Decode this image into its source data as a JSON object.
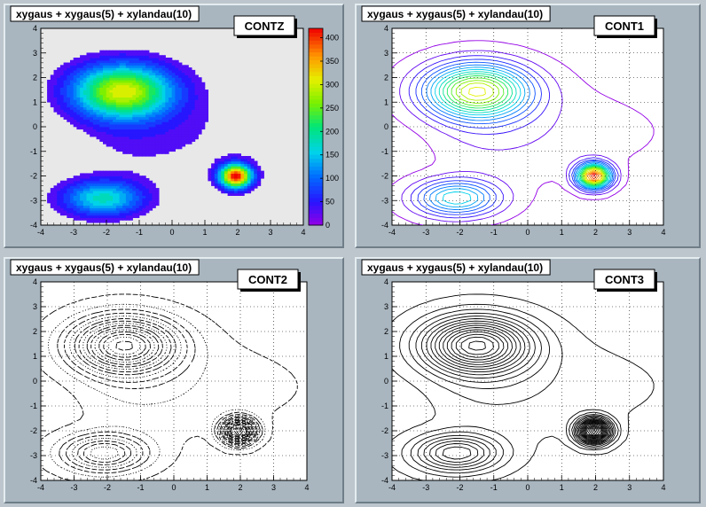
{
  "canvas_bg": "#bcc6cc",
  "pad_bg": "#a9b6c0",
  "frame_bg": "#e8e8e8",
  "chart_data": [
    {
      "type": "heatmap",
      "title": "xygaus + xygaus(5) + xylandau(10)",
      "draw_option": "CONTZ",
      "style": "filled",
      "xlim": [
        -4,
        4
      ],
      "ylim": [
        -4,
        4
      ],
      "x_ticks": [
        "-4",
        "-3",
        "-2",
        "-1",
        "0",
        "1",
        "2",
        "3",
        "4"
      ],
      "y_ticks": [
        "-4",
        "-3",
        "-2",
        "-1",
        "0",
        "1",
        "2",
        "3",
        "4"
      ],
      "grid": false,
      "palette": {
        "min": 0,
        "max": 420,
        "labels": [
          "0",
          "50",
          "100",
          "150",
          "200",
          "250",
          "300",
          "350",
          "400"
        ]
      }
    },
    {
      "type": "heatmap",
      "title": "xygaus + xygaus(5) + xylandau(10)",
      "draw_option": "CONT1",
      "style": "colored-lines",
      "xlim": [
        -4,
        4
      ],
      "ylim": [
        -4,
        4
      ],
      "x_ticks": [
        "-4",
        "-3",
        "-2",
        "-1",
        "0",
        "1",
        "2",
        "3",
        "4"
      ],
      "y_ticks": [
        "-4",
        "-3",
        "-2",
        "-1",
        "0",
        "1",
        "2",
        "3",
        "4"
      ],
      "grid": true
    },
    {
      "type": "heatmap",
      "title": "xygaus + xygaus(5) + xylandau(10)",
      "draw_option": "CONT2",
      "style": "dashed-lines",
      "xlim": [
        -4,
        4
      ],
      "ylim": [
        -4,
        4
      ],
      "x_ticks": [
        "-4",
        "-3",
        "-2",
        "-1",
        "0",
        "1",
        "2",
        "3",
        "4"
      ],
      "y_ticks": [
        "-4",
        "-3",
        "-2",
        "-1",
        "0",
        "1",
        "2",
        "3",
        "4"
      ],
      "grid": true
    },
    {
      "type": "heatmap",
      "title": "xygaus + xygaus(5) + xylandau(10)",
      "draw_option": "CONT3",
      "style": "solid-lines",
      "xlim": [
        -4,
        4
      ],
      "ylim": [
        -4,
        4
      ],
      "x_ticks": [
        "-4",
        "-3",
        "-2",
        "-1",
        "0",
        "1",
        "2",
        "3",
        "4"
      ],
      "y_ticks": [
        "-4",
        "-3",
        "-2",
        "-1",
        "0",
        "1",
        "2",
        "3",
        "4"
      ],
      "grid": true
    }
  ]
}
